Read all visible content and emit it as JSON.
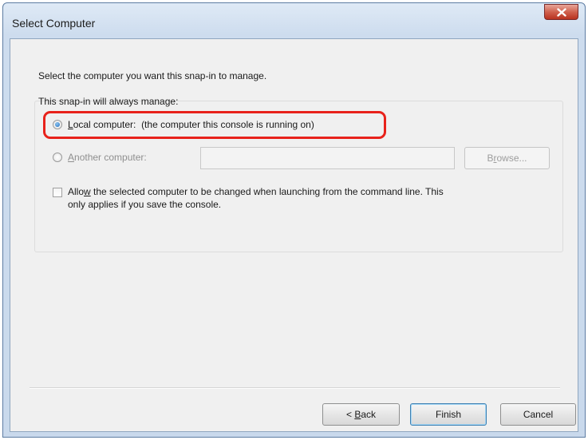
{
  "window": {
    "title": "Select Computer"
  },
  "instruction": "Select the computer you want this snap-in to manage.",
  "group": {
    "label": "This snap-in will always manage:",
    "local_option": {
      "label_accel": "L",
      "label_rest": "ocal computer:",
      "label_detail": "(the computer this console is running on)",
      "selected": true
    },
    "another_option": {
      "label_accel": "A",
      "label_rest": "nother computer:",
      "selected": false,
      "value": ""
    },
    "browse_button": {
      "label_pre": "B",
      "label_accel": "r",
      "label_rest": "owse..."
    },
    "allow_checkbox": {
      "line1_pre": "Allo",
      "line1_accel": "w",
      "line1_rest": " the selected computer to be changed when launching from the command line.  This",
      "line2": "only applies if you save the console.",
      "checked": false
    }
  },
  "buttons": {
    "back": {
      "pre": "< ",
      "accel": "B",
      "rest": "ack"
    },
    "finish": "Finish",
    "cancel": "Cancel"
  },
  "colors": {
    "highlight": "#e8221b",
    "title_bar": "#cddcee",
    "close_button": "#c9412f"
  }
}
